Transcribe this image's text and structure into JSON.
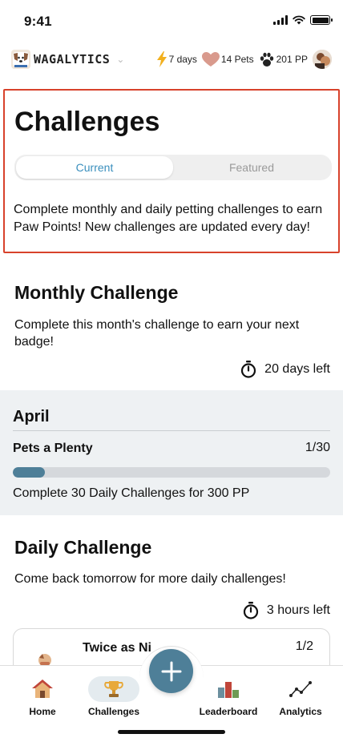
{
  "status_bar": {
    "time": "9:41"
  },
  "header": {
    "app_name": "WAGALYTICS",
    "streak": "7 days",
    "pets": "14 Pets",
    "points": "201 PP"
  },
  "top": {
    "title": "Challenges",
    "tabs": [
      {
        "label": "Current",
        "selected": true
      },
      {
        "label": "Featured",
        "selected": false
      }
    ],
    "description": "Complete monthly and daily petting challenges to earn Paw Points! New challenges are updated every day!"
  },
  "monthly": {
    "title": "Monthly Challenge",
    "description": "Complete this month's challenge to earn your next badge!",
    "time_left": "20 days left",
    "card": {
      "month": "April",
      "challenge_name": "Pets a Plenty",
      "count": "1/30",
      "progress": 0.0333,
      "reward": "Complete 30 Daily Challenges for 300 PP"
    }
  },
  "daily": {
    "title": "Daily Challenge",
    "description": "Come back tomorrow for more daily challenges!",
    "time_left": "3 hours left",
    "card": {
      "name": "Twice as Ni",
      "count": "1/2"
    }
  },
  "tab_bar": {
    "items": [
      {
        "label": "Home",
        "icon": "home-icon"
      },
      {
        "label": "Challenges",
        "icon": "trophy-icon",
        "active": true
      },
      {
        "label": "Leaderboard",
        "icon": "leaderboard-icon"
      },
      {
        "label": "Analytics",
        "icon": "analytics-icon"
      }
    ],
    "fab_icon": "plus-icon"
  },
  "colors": {
    "accent": "#4e7f98",
    "tab_selected_text": "#3a8fbd",
    "highlight_border": "#d8422b",
    "card_bg": "#eef1f3"
  }
}
